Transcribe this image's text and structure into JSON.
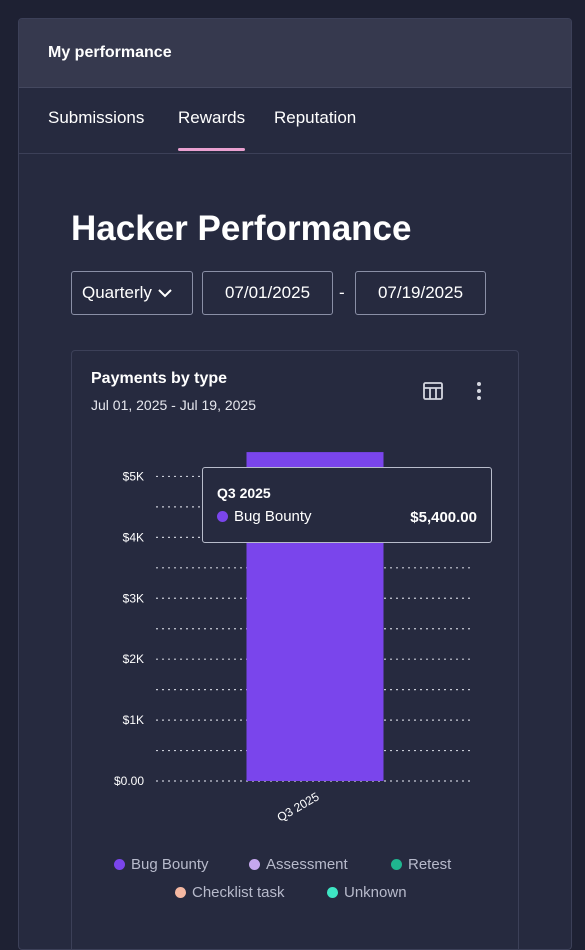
{
  "header": {
    "title": "My performance"
  },
  "tabs": [
    {
      "label": "Submissions"
    },
    {
      "label": "Rewards"
    },
    {
      "label": "Reputation"
    }
  ],
  "page": {
    "title": "Hacker Performance"
  },
  "filters": {
    "period": "Quarterly",
    "start_date": "07/01/2025",
    "separator": "-",
    "end_date": "07/19/2025"
  },
  "card": {
    "title": "Payments by type",
    "subtitle": "Jul 01, 2025 - Jul 19, 2025",
    "icons": [
      "table-icon",
      "more-vertical-icon"
    ]
  },
  "tooltip": {
    "title": "Q3 2025",
    "series": "Bug Bounty",
    "value": "$5,400.00",
    "color": "#7a45ec"
  },
  "legend": [
    {
      "label": "Bug Bounty",
      "color": "#7a45ec"
    },
    {
      "label": "Assessment",
      "color": "#c6a8ef"
    },
    {
      "label": "Retest",
      "color": "#1fb58f"
    },
    {
      "label": "Checklist task",
      "color": "#f5b8a2"
    },
    {
      "label": "Unknown",
      "color": "#3ee6c4"
    }
  ],
  "chart_data": {
    "type": "bar",
    "title": "Payments by type",
    "subtitle": "Jul 01, 2025 - Jul 19, 2025",
    "categories": [
      "Q3 2025"
    ],
    "series": [
      {
        "name": "Bug Bounty",
        "values": [
          5400
        ],
        "color": "#7a45ec"
      },
      {
        "name": "Assessment",
        "values": [
          0
        ],
        "color": "#c6a8ef"
      },
      {
        "name": "Retest",
        "values": [
          0
        ],
        "color": "#1fb58f"
      },
      {
        "name": "Checklist task",
        "values": [
          0
        ],
        "color": "#f5b8a2"
      },
      {
        "name": "Unknown",
        "values": [
          0
        ],
        "color": "#3ee6c4"
      }
    ],
    "y_ticks": [
      "$0.00",
      "$1K",
      "$2K",
      "$3K",
      "$4K",
      "$5K"
    ],
    "ylim": [
      0,
      5500
    ],
    "grid": true,
    "legend_position": "bottom"
  }
}
